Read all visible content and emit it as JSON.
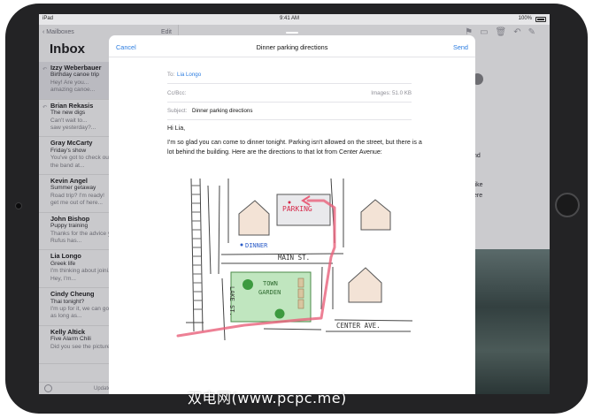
{
  "status_bar": {
    "carrier": "iPad",
    "time": "9:41 AM",
    "battery": "100%"
  },
  "inbox": {
    "back_label": "Mailboxes",
    "edit_label": "Edit",
    "title": "Inbox",
    "messages": [
      {
        "from": "Izzy Weberbauer",
        "subject": "Birthday canoe trip",
        "preview1": "Hey! Are you...",
        "preview2": "amazing canoe..."
      },
      {
        "from": "Brian Rekasis",
        "subject": "The new digs",
        "preview1": "Can't wait to...",
        "preview2": "saw yesterday?..."
      },
      {
        "from": "Gray McCarty",
        "subject": "Friday's show",
        "preview1": "You've got to check out",
        "preview2": "the band at..."
      },
      {
        "from": "Kevin Angel",
        "subject": "Summer getaway",
        "preview1": "Road trip? I'm ready!",
        "preview2": "get me out of here..."
      },
      {
        "from": "John Bishop",
        "subject": "Puppy training",
        "preview1": "Thanks for the advice y...",
        "preview2": "Rufus has..."
      },
      {
        "from": "Lia Longo",
        "subject": "Greek life",
        "preview1": "I'm thinking about joini...",
        "preview2": "Hey, I'm..."
      },
      {
        "from": "Cindy Cheung",
        "subject": "Thai tonight?",
        "preview1": "I'm up for it, we can go...",
        "preview2": "as long as..."
      },
      {
        "from": "Kelly Altick",
        "subject": "Five Alarm Chili",
        "preview1": "Did you see the pictures...",
        "preview2": ""
      }
    ],
    "footer_status": "Updated"
  },
  "reading_pane": {
    "fragments": [
      "nd",
      "like",
      "ere"
    ]
  },
  "compose": {
    "cancel_label": "Cancel",
    "title": "Dinner parking directions",
    "send_label": "Send",
    "to_label": "To:",
    "to_value": "Lia Longo",
    "cc_label": "Cc/Bcc:",
    "images_label": "Images: 51.0 KB",
    "subject_label": "Subject:",
    "subject_value": "Dinner parking directions",
    "greeting": "Hi Lia,",
    "body": "I'm so glad you can come to dinner tonight. Parking isn't allowed on the street, but there is a lot behind the building. Here are the directions to that lot from Center Avenue:"
  },
  "map": {
    "labels": {
      "parking": "PARKING",
      "dinner": "DINNER",
      "main_st": "MAIN ST.",
      "town_garden_1": "TOWN",
      "town_garden_2": "GARDEN",
      "lake_st": "LAKE ST.",
      "center_ave": "CENTER AVE."
    },
    "route_color": "#e8607a",
    "garden_color": "#8cd18a"
  },
  "watermark": "双电网(www.pcpc.me)",
  "icons": [
    "flag-icon",
    "folder-icon",
    "trash-icon",
    "reply-icon",
    "compose-icon",
    "filter-icon"
  ]
}
